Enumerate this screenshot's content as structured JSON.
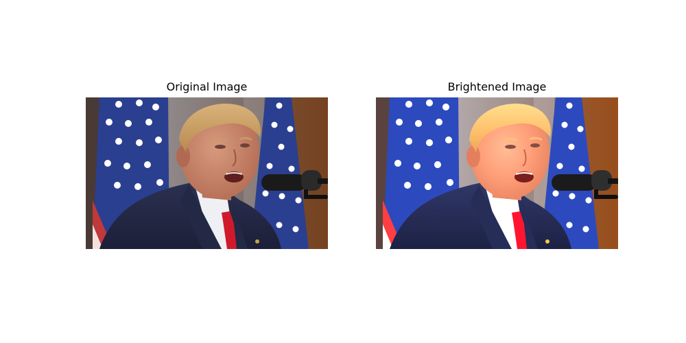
{
  "figure": {
    "panels": [
      {
        "title": "Original Image",
        "brightness": 1.0
      },
      {
        "title": "Brightened Image",
        "brightness": 1.22
      }
    ]
  }
}
